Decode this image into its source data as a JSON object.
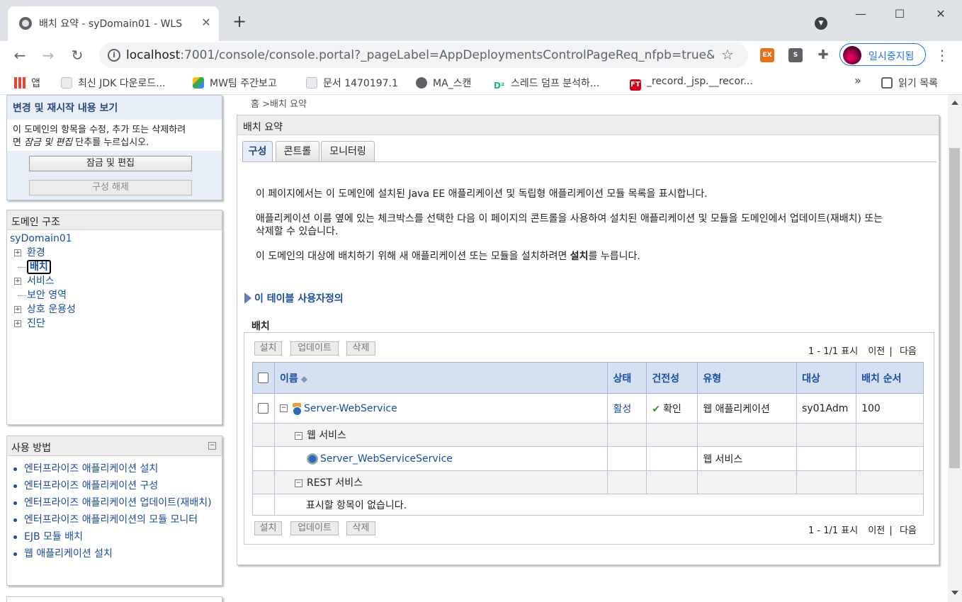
{
  "browser": {
    "tab_title": "배치 요약 - syDomain01 - WLS",
    "tab_close": "✕",
    "new_tab": "+",
    "url_host": "localhost",
    "url_rest": ":7001/console/console.portal?_pageLabel=AppDeploymentsControlPageReq_nfpb=true&AppDe...",
    "profile_label": "일시중지됨",
    "extensions": [
      {
        "name": "EX",
        "color": "#e8711c"
      },
      {
        "name": "S",
        "color": "#5f6368"
      }
    ],
    "bookmarks": [
      {
        "label": "앱",
        "icon": "apps-grid-icon"
      },
      {
        "label": "최신 JDK 다운로드...",
        "icon": "page-icon"
      },
      {
        "label": "MW팀 주간보고",
        "icon": "drive-icon"
      },
      {
        "label": "문서 1470197.1",
        "icon": "page-icon"
      },
      {
        "label": "MA_스캔",
        "icon": "globe-icon"
      },
      {
        "label": "스레드 덤프 분석하...",
        "icon": "d2-icon"
      },
      {
        "label": "_record._jsp.__recor...",
        "icon": "ft-icon"
      }
    ],
    "bookmarks_more": "»",
    "reading_list": "읽기 목록"
  },
  "left": {
    "changes": {
      "title": "변경 및 재시작 내용 보기",
      "desc_line1": "이 도메인의 항목을 수정, 추가 또는 삭제하려",
      "desc_line2_pre": "면 ",
      "desc_line2_em": "잠금 및 편집",
      "desc_line2_post": " 단추를 누르십시오.",
      "lock_button": "잠금 및 편집",
      "release_button": "구성 해제"
    },
    "tree": {
      "title": "도메인 구조",
      "root": "syDomain01",
      "nodes": [
        "환경",
        "배치",
        "서비스",
        "보안 영역",
        "상호 운용성",
        "진단"
      ]
    },
    "howto": {
      "title": "사용 방법",
      "collapse": "−",
      "items": [
        "엔터프라이즈 애플리케이션 설치",
        "엔터프라이즈 애플리케이션 구성",
        "엔터프라이즈 애플리케이션 업데이트(재배치)",
        "엔터프라이즈 애플리케이션의 모듈 모니터",
        "EJB 모듈 배치",
        "웹 애플리케이션 설치"
      ]
    }
  },
  "main": {
    "breadcrumb": "홈 >배치 요약",
    "panel_title": "배치 요약",
    "tabs": [
      "구성",
      "콘트롤",
      "모니터링"
    ],
    "para1": "이 페이지에서는 이 도메인에 설치된 Java EE 애플리케이션 및 독립형 애플리케이션 모듈 목록을 표시합니다.",
    "para2_line1": "애플리케이션 이름 옆에 있는 체크박스를 선택한 다음 이 페이지의 콘트롤을 사용하여 설치된 애플리케이션 및 모듈을 도메인에서 업데이트(재배치) 또는",
    "para2_line2": "삭제할 수 있습니다.",
    "para3_pre": "이 도메인의 대상에 배치하기 위해 새 애플리케이션 또는 모듈을 설치하려면 ",
    "para3_bold": "설치",
    "para3_post": "를 누릅니다.",
    "customize": "이 테이블 사용자정의",
    "section": "배치",
    "buttons": {
      "install": "설치",
      "update": "업데이트",
      "delete": "삭제"
    },
    "pager": {
      "range": "1 - 1/1 표시",
      "prev": "이전",
      "sep": "|",
      "next": "다음"
    },
    "table": {
      "headers": [
        "이름",
        "상태",
        "건전성",
        "유형",
        "대상",
        "배치 순서"
      ],
      "sort_icon": "⌃",
      "app": {
        "name": "Server-WebService",
        "state": "활성",
        "health": "확인",
        "type": "웹 애플리케이션",
        "target": "sy01Adm",
        "order": "100"
      },
      "webservices_label": "웹 서비스",
      "service": {
        "name": "Server_WebServiceService",
        "type": "웹 서비스"
      },
      "rest_label": "REST 서비스",
      "empty_text": "표시할 항목이 없습니다."
    }
  }
}
